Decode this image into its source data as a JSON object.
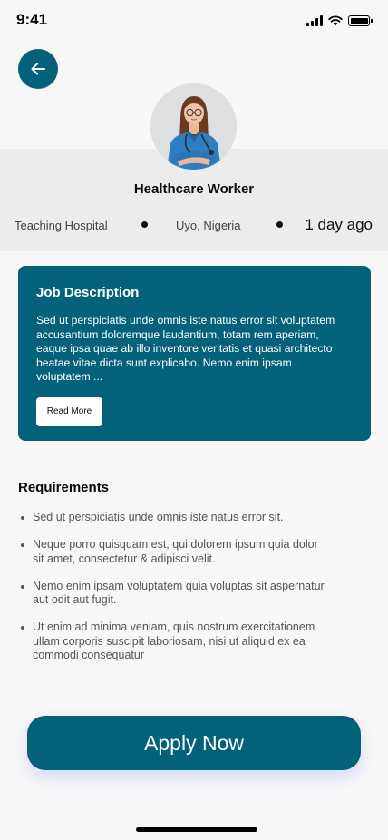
{
  "status_bar": {
    "time": "9:41"
  },
  "profile": {
    "job_title": "Healthcare Worker",
    "organization": "Teaching Hospital",
    "location": "Uyo, Nigeria",
    "posted": "1 day ago"
  },
  "description": {
    "title": "Job Description",
    "text": "Sed ut perspiciatis unde omnis iste natus error sit voluptatem accusantium doloremque laudantium, totam rem aperiam, eaque ipsa quae ab illo inventore veritatis et quasi architecto beatae vitae dicta sunt explicabo. Nemo enim ipsam voluptatem ...",
    "read_more_label": "Read More"
  },
  "requirements": {
    "title": "Requirements",
    "items": [
      "Sed ut perspiciatis unde omnis iste natus error sit.",
      "Neque porro quisquam est, qui dolorem ipsum quia dolor sit amet, consectetur & adipisci velit.",
      "Nemo enim ipsam voluptatem quia voluptas sit aspernatur aut odit aut fugit.",
      "Ut enim ad minima veniam, quis nostrum exercitationem ullam corporis suscipit laboriosam, nisi ut aliquid ex ea commodi consequatur"
    ]
  },
  "apply_label": "Apply Now",
  "colors": {
    "accent": "#03627a",
    "background": "#f7f7f8",
    "band": "#ececec"
  },
  "icons": {
    "back": "arrow-left-icon"
  }
}
